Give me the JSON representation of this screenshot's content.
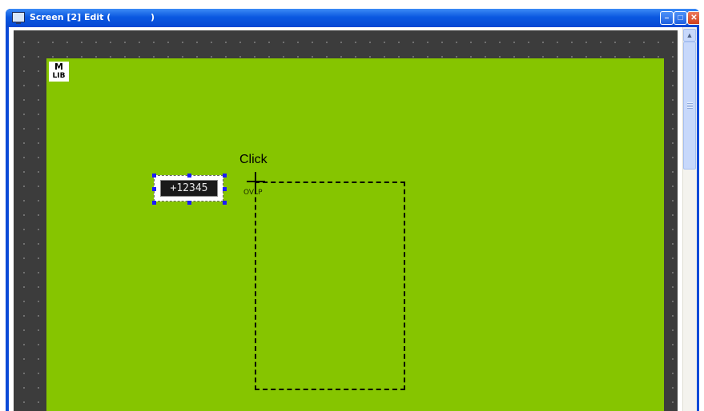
{
  "window": {
    "title": "Screen [2] Edit (             )",
    "buttons": {
      "minimize": "–",
      "maximize": "□",
      "close": "✕"
    }
  },
  "canvas": {
    "lib_logo": {
      "line1": "M",
      "line2": "LIB"
    },
    "part": {
      "display_value": "+12345"
    },
    "click_label": "Click",
    "ovlp_label": "OVLP"
  },
  "scrollbar": {
    "up_arrow": "▲"
  },
  "colors": {
    "titlebar": "#0b58e0",
    "canvas_background": "#3c3c3c",
    "screen_area": "#86c500",
    "selection_handles": "#1a1aff"
  }
}
